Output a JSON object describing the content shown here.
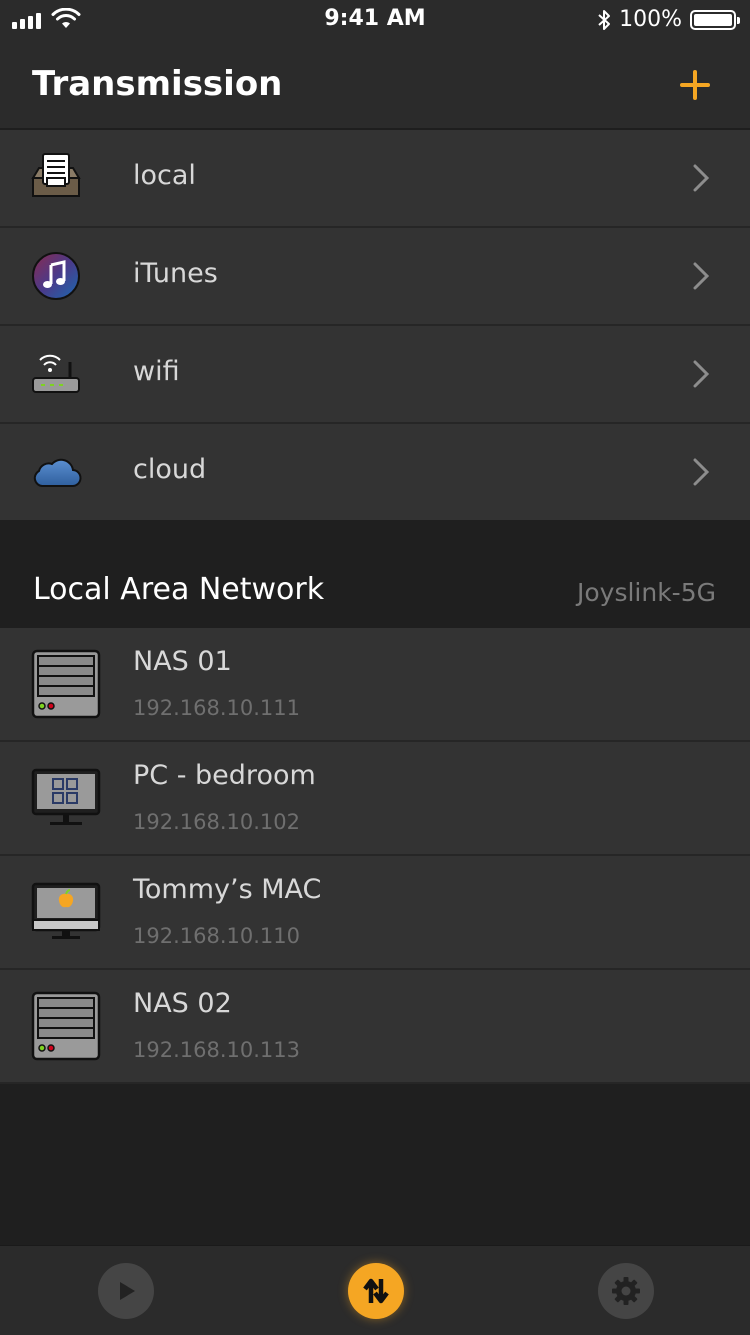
{
  "status_bar": {
    "time": "9:41 AM",
    "battery": "100%"
  },
  "nav": {
    "title": "Transmission",
    "add_icon": "plus-icon",
    "accent": "#f5a623"
  },
  "sources": [
    {
      "label": "local",
      "icon": "inbox-document-icon"
    },
    {
      "label": "iTunes",
      "icon": "itunes-music-icon"
    },
    {
      "label": "wifi",
      "icon": "wifi-router-icon"
    },
    {
      "label": "cloud",
      "icon": "cloud-icon"
    }
  ],
  "lan": {
    "title": "Local Area Network",
    "network_name": "Joyslink-5G",
    "devices": [
      {
        "name": "NAS 01",
        "ip": "192.168.10.111",
        "icon": "nas-server-icon"
      },
      {
        "name": "PC - bedroom",
        "ip": "192.168.10.102",
        "icon": "windows-pc-icon"
      },
      {
        "name": "Tommy’s MAC",
        "ip": "192.168.10.110",
        "icon": "mac-computer-icon"
      },
      {
        "name": "NAS 02",
        "ip": "192.168.10.113",
        "icon": "nas-server-icon"
      }
    ]
  },
  "tabbar": {
    "tabs": [
      {
        "icon": "play-icon",
        "active": false
      },
      {
        "icon": "transfer-arrows-icon",
        "active": true
      },
      {
        "icon": "gear-icon",
        "active": false
      }
    ]
  }
}
